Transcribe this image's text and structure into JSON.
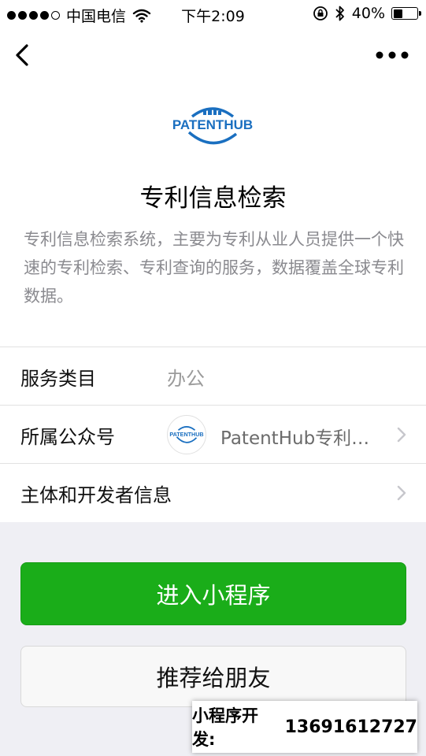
{
  "status_bar": {
    "carrier": "中国电信",
    "time": "下午2:09",
    "battery": "40%",
    "battery_level": 0.4
  },
  "header": {
    "logo_text": "PATENTHUB",
    "title": "专利信息检索",
    "description": "专利信息检索系统，主要为专利从业人员提供一个快速的专利检索、专利查询的服务，数据覆盖全球专利数据。"
  },
  "info": {
    "category_label": "服务类目",
    "category_value": "办公",
    "account_label": "所属公众号",
    "account_name": "PatentHub专利检索",
    "developer_label": "主体和开发者信息"
  },
  "buttons": {
    "enter": "进入小程序",
    "share": "推荐给朋友"
  },
  "watermark": {
    "label": "小程序开发:",
    "phone": "13691612727"
  },
  "colors": {
    "primary_green": "#1aad19",
    "logo_blue": "#1a6fc0"
  },
  "icons": [
    "back-icon",
    "more-icon",
    "wifi-icon",
    "lock-rotation-icon",
    "bluetooth-icon",
    "battery-icon",
    "chevron-right-icon"
  ]
}
